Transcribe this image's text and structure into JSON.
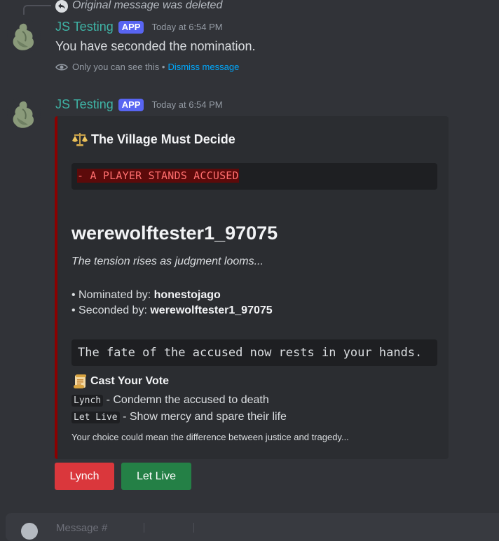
{
  "reply": {
    "text": "Original message was deleted"
  },
  "message1": {
    "username": "JS Testing",
    "tag": "APP",
    "timestamp": "Today at 6:54 PM",
    "text": "You have seconded the nomination.",
    "ephemeral_text": "Only you can see this •",
    "dismiss_label": "Dismiss message"
  },
  "message2": {
    "username": "JS Testing",
    "tag": "APP",
    "timestamp": "Today at 6:54 PM",
    "embed": {
      "accent_color": "#8b0000",
      "title": "The Village Must Decide",
      "accused_banner": "- A PLAYER STANDS ACCUSED",
      "accused_name": "werewolftester1_97075",
      "tension": "The tension rises as judgment looms...",
      "nominated_label": "• Nominated by: ",
      "nominated_value": "honestojago",
      "seconded_label": "• Seconded by: ",
      "seconded_value": "werewolftester1_97075",
      "fate_text": "The fate of the accused now rests in your hands.",
      "vote_heading": "Cast Your Vote",
      "option1_code": "Lynch",
      "option1_text": " - Condemn the accused to death",
      "option2_code": "Let Live",
      "option2_text": " - Show mercy and spare their life",
      "footer": "Your choice could mean the difference between justice and tragedy..."
    },
    "buttons": {
      "lynch": "Lynch",
      "let_live": "Let Live"
    }
  },
  "composer": {
    "placeholder": "Message #"
  },
  "colors": {
    "background": "#313338",
    "embed_bg": "#2b2d31",
    "username": "#3fb4a6",
    "app_tag": "#5865f2",
    "danger_button": "#da373c",
    "success_button": "#248046",
    "link": "#00a8fc"
  }
}
